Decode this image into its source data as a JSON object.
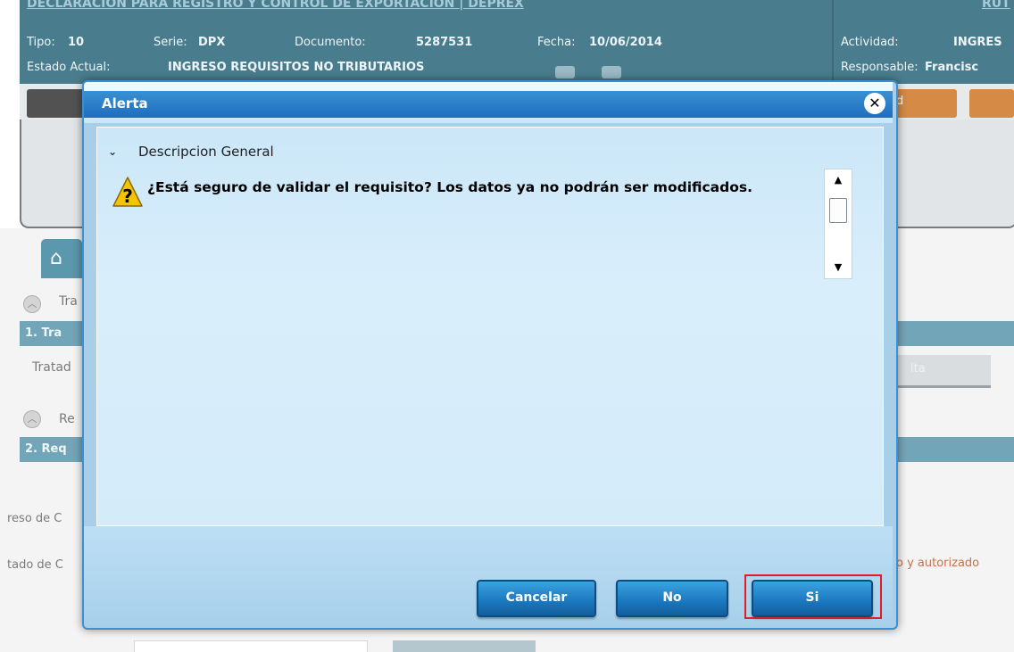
{
  "background": {
    "header": {
      "title": "DECLARACION PARA REGISTRO Y CONTROL DE EXPORTACION | DEPREX",
      "title_right": "RUT",
      "tipo_label": "Tipo:",
      "tipo_value": "10",
      "serie_label": "Serie:",
      "serie_value": "DPX",
      "documento_label": "Documento:",
      "documento_value": "5287531",
      "fecha_label": "Fecha:",
      "fecha_value": "10/06/2014",
      "estado_label": "Estado Actual:",
      "estado_value": "INGRESO REQUISITOS NO TRIBUTARIOS",
      "actividad_label": "Actividad:",
      "actividad_value": "INGRES",
      "responsable_label": "Responsable:",
      "responsable_value": "Francisc"
    },
    "toolbar": {
      "orange_btn_fragment": "d"
    },
    "sections": {
      "section1_fragment": "Tra",
      "section1_bar": "1. Tra",
      "row_label": "Tratad",
      "action_fragment": "lta",
      "section2_fragment": "Re",
      "section2_bar": "2. Req",
      "row_ingreso": "reso de C",
      "row_estado": "tado de C",
      "autorizado_text": "o y autorizado"
    }
  },
  "dialog": {
    "title": "Alerta",
    "section_title": "Descripcion General",
    "message": "¿Está seguro de validar el requisito? Los datos ya no podrán ser modificados.",
    "buttons": {
      "cancelar": "Cancelar",
      "no": "No",
      "si": "Si"
    }
  },
  "colors": {
    "header_bg": "#17596e",
    "dialog_title_bg": "#1d6ec0",
    "button_bg": "#1a77be",
    "highlight": "#e01c24",
    "warning": "#f5c400"
  }
}
